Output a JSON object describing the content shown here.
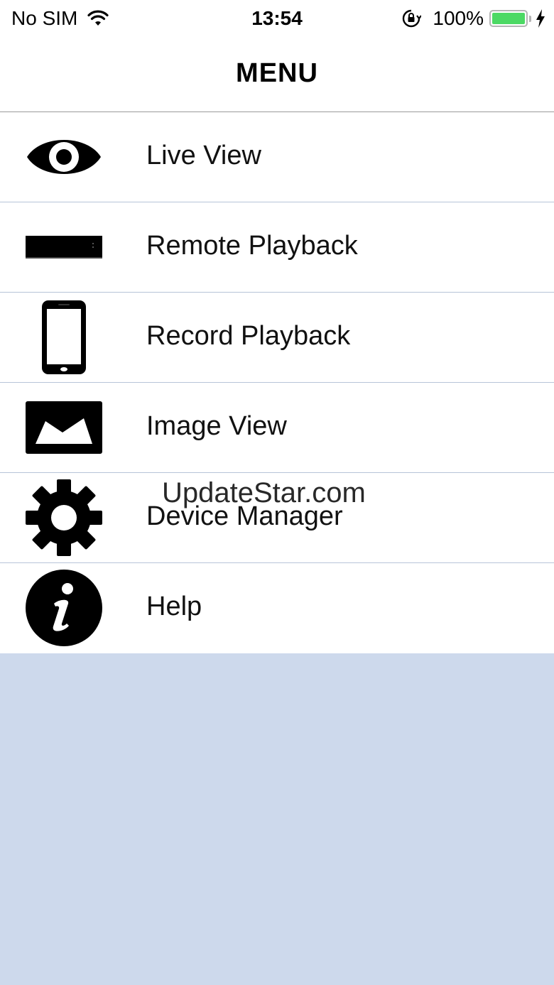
{
  "status_bar": {
    "carrier": "No SIM",
    "time": "13:54",
    "battery": "100%",
    "battery_level": 1.0,
    "icons": [
      "wifi-icon",
      "orientation-lock-icon",
      "battery-icon",
      "charging-bolt-icon"
    ]
  },
  "nav": {
    "title": "MENU"
  },
  "menu": {
    "items": [
      {
        "label": "Live View",
        "icon": "eye-icon"
      },
      {
        "label": "Remote Playback",
        "icon": "dvr-recorder-icon"
      },
      {
        "label": "Record Playback",
        "icon": "smartphone-icon"
      },
      {
        "label": "Image View",
        "icon": "image-icon"
      },
      {
        "label": "Device Manager",
        "icon": "gear-icon"
      },
      {
        "label": "Help",
        "icon": "info-icon"
      }
    ]
  },
  "watermark": "UpdateStar.com",
  "colors": {
    "background": "#cdd9ec",
    "battery_green": "#4cd964",
    "separator": "#b7c4d8"
  }
}
